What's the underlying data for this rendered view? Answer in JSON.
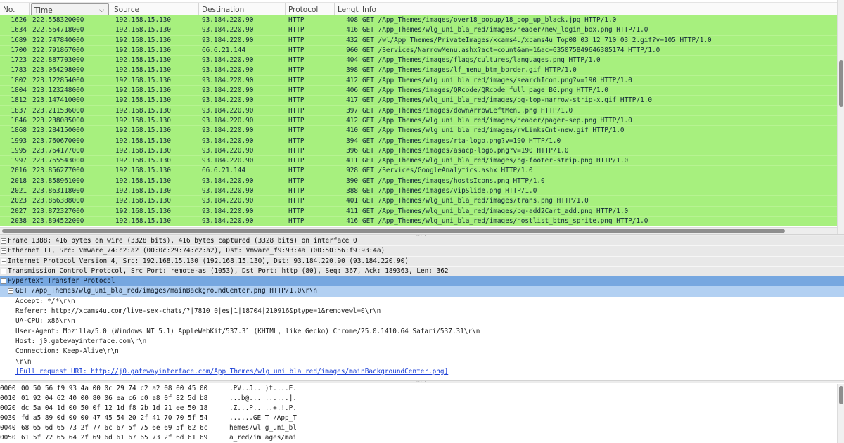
{
  "packet_list": {
    "columns": {
      "no": "No.",
      "time": "Time",
      "source": "Source",
      "destination": "Destination",
      "protocol": "Protocol",
      "length": "Lengtl",
      "info": "Info"
    },
    "rows": [
      {
        "no": "1626",
        "time": "222.558320000",
        "src": "192.168.15.130",
        "dst": "93.184.220.90",
        "proto": "HTTP",
        "len": "408",
        "info": "GET /App_Themes/images/over18_popup/18_pop_up_black.jpg HTTP/1.0"
      },
      {
        "no": "1634",
        "time": "222.564718000",
        "src": "192.168.15.130",
        "dst": "93.184.220.90",
        "proto": "HTTP",
        "len": "416",
        "info": "GET /App_Themes/wlg_uni_bla_red/images/header/new_login_box.png HTTP/1.0"
      },
      {
        "no": "1689",
        "time": "222.747840000",
        "src": "192.168.15.130",
        "dst": "93.184.220.90",
        "proto": "HTTP",
        "len": "432",
        "info": "GET /wl/App_Themes/PrivateImages/xcams4u/xcams4u_Top08_03_12_710_03_2.gif?v=105 HTTP/1.0"
      },
      {
        "no": "1700",
        "time": "222.791867000",
        "src": "192.168.15.130",
        "dst": "66.6.21.144",
        "proto": "HTTP",
        "len": "960",
        "info": "GET /Services/NarrowMenu.ashx?act=count&am=1&ac=635075849646385174 HTTP/1.0"
      },
      {
        "no": "1723",
        "time": "222.887703000",
        "src": "192.168.15.130",
        "dst": "93.184.220.90",
        "proto": "HTTP",
        "len": "404",
        "info": "GET /App_Themes/images/flags/cultures/languages.png HTTP/1.0"
      },
      {
        "no": "1783",
        "time": "223.064298000",
        "src": "192.168.15.130",
        "dst": "93.184.220.90",
        "proto": "HTTP",
        "len": "398",
        "info": "GET /App_Themes/images/lf_menu_btm_border.gif HTTP/1.0"
      },
      {
        "no": "1802",
        "time": "223.122854000",
        "src": "192.168.15.130",
        "dst": "93.184.220.90",
        "proto": "HTTP",
        "len": "412",
        "info": "GET /App_Themes/wlg_uni_bla_red/images/searchIcon.png?v=190 HTTP/1.0"
      },
      {
        "no": "1804",
        "time": "223.123248000",
        "src": "192.168.15.130",
        "dst": "93.184.220.90",
        "proto": "HTTP",
        "len": "406",
        "info": "GET /App_Themes/images/QRcode/QRcode_full_page_BG.png HTTP/1.0"
      },
      {
        "no": "1812",
        "time": "223.147410000",
        "src": "192.168.15.130",
        "dst": "93.184.220.90",
        "proto": "HTTP",
        "len": "417",
        "info": "GET /App_Themes/wlg_uni_bla_red/images/bg-top-narrow-strip-x.gif HTTP/1.0"
      },
      {
        "no": "1837",
        "time": "223.211536000",
        "src": "192.168.15.130",
        "dst": "93.184.220.90",
        "proto": "HTTP",
        "len": "397",
        "info": "GET /App_Themes/images/downArrowLeftMenu.png HTTP/1.0"
      },
      {
        "no": "1846",
        "time": "223.238085000",
        "src": "192.168.15.130",
        "dst": "93.184.220.90",
        "proto": "HTTP",
        "len": "412",
        "info": "GET /App_Themes/wlg_uni_bla_red/images/header/pager-sep.png HTTP/1.0"
      },
      {
        "no": "1868",
        "time": "223.284150000",
        "src": "192.168.15.130",
        "dst": "93.184.220.90",
        "proto": "HTTP",
        "len": "410",
        "info": "GET /App_Themes/wlg_uni_bla_red/images/rvLinksCnt-new.gif HTTP/1.0"
      },
      {
        "no": "1993",
        "time": "223.760670000",
        "src": "192.168.15.130",
        "dst": "93.184.220.90",
        "proto": "HTTP",
        "len": "394",
        "info": "GET /App_Themes/images/rta-logo.png?v=190 HTTP/1.0"
      },
      {
        "no": "1995",
        "time": "223.764177000",
        "src": "192.168.15.130",
        "dst": "93.184.220.90",
        "proto": "HTTP",
        "len": "396",
        "info": "GET /App_Themes/images/asacp-logo.png?v=190 HTTP/1.0"
      },
      {
        "no": "1997",
        "time": "223.765543000",
        "src": "192.168.15.130",
        "dst": "93.184.220.90",
        "proto": "HTTP",
        "len": "411",
        "info": "GET /App_Themes/wlg_uni_bla_red/images/bg-footer-strip.png HTTP/1.0"
      },
      {
        "no": "2016",
        "time": "223.856277000",
        "src": "192.168.15.130",
        "dst": "66.6.21.144",
        "proto": "HTTP",
        "len": "928",
        "info": "GET /Services/GoogleAnalytics.ashx HTTP/1.0"
      },
      {
        "no": "2018",
        "time": "223.858961000",
        "src": "192.168.15.130",
        "dst": "93.184.220.90",
        "proto": "HTTP",
        "len": "390",
        "info": "GET /App_Themes/images/hostsIcons.png HTTP/1.0"
      },
      {
        "no": "2021",
        "time": "223.863118000",
        "src": "192.168.15.130",
        "dst": "93.184.220.90",
        "proto": "HTTP",
        "len": "388",
        "info": "GET /App_Themes/images/vipSlide.png HTTP/1.0"
      },
      {
        "no": "2023",
        "time": "223.866388000",
        "src": "192.168.15.130",
        "dst": "93.184.220.90",
        "proto": "HTTP",
        "len": "401",
        "info": "GET /App_Themes/wlg_uni_bla_red/images/trans.png HTTP/1.0"
      },
      {
        "no": "2027",
        "time": "223.872327000",
        "src": "192.168.15.130",
        "dst": "93.184.220.90",
        "proto": "HTTP",
        "len": "411",
        "info": "GET /App_Themes/wlg_uni_bla_red/images/bg-add2Cart_add.png HTTP/1.0"
      },
      {
        "no": "2038",
        "time": "223.894522000",
        "src": "192.168.15.130",
        "dst": "93.184.220.90",
        "proto": "HTTP",
        "len": "416",
        "info": "GET /App_Themes/wlg_uni_bla_red/images/hostlist_btns_sprite.png HTTP/1.0"
      }
    ]
  },
  "details": {
    "frame": "Frame 1388: 416 bytes on wire (3328 bits), 416 bytes captured (3328 bits) on interface 0",
    "ethernet": "Ethernet II, Src: Vmware_74:c2:a2 (00:0c:29:74:c2:a2), Dst: Vmware_f9:93:4a (00:50:56:f9:93:4a)",
    "ip": "Internet Protocol Version 4, Src: 192.168.15.130 (192.168.15.130), Dst: 93.184.220.90 (93.184.220.90)",
    "tcp": "Transmission Control Protocol, Src Port: remote-as (1053), Dst Port: http (80), Seq: 367, Ack: 189363, Len: 362",
    "http": "Hypertext Transfer Protocol",
    "request_line": "GET /App_Themes/wlg_uni_bla_red/images/mainBackgroundCenter.png HTTP/1.0\\r\\n",
    "headers": [
      "Accept: */*\\r\\n",
      "Referer: http://xcams4u.com/live-sex-chats/?|7810|0|es|1|18704|210916&ptype=1&removewl=0\\r\\n",
      "UA-CPU: x86\\r\\n",
      "User-Agent: Mozilla/5.0 (Windows NT 5.1) AppleWebKit/537.31 (KHTML, like Gecko) Chrome/25.0.1410.64 Safari/537.31\\r\\n",
      "Host: j0.gatewayinterface.com\\r\\n",
      "Connection: Keep-Alive\\r\\n",
      "\\r\\n"
    ],
    "full_uri": "[Full request URI: http://j0.gatewayinterface.com/App_Themes/wlg_uni_bla_red/images/mainBackgroundCenter.png]",
    "expand_plus": "+",
    "expand_minus": "−"
  },
  "bytes": [
    {
      "offset": "0000",
      "hex": "00 50 56 f9 93 4a 00 0c  29 74 c2 a2 08 00 45 00",
      "ascii": ".PV..J.. )t....E."
    },
    {
      "offset": "0010",
      "hex": "01 92 04 62 40 00 80 06  ea c6 c0 a8 0f 82 5d b8",
      "ascii": "...b@... ......]."
    },
    {
      "offset": "0020",
      "hex": "dc 5a 04 1d 00 50 0f 12  1d f8 2b 1d 21 ee 50 18",
      "ascii": ".Z...P.. ..+.!.P."
    },
    {
      "offset": "0030",
      "hex": "fd a5 89 0d 00 00 47 45  54 20 2f 41 70 70 5f 54",
      "ascii": "......GE T /App_T"
    },
    {
      "offset": "0040",
      "hex": "68 65 6d 65 73 2f 77 6c  67 5f 75 6e 69 5f 62 6c",
      "ascii": "hemes/wl g_uni_bl"
    },
    {
      "offset": "0050",
      "hex": "61 5f 72 65 64 2f 69 6d  61 67 65 73 2f 6d 61 69",
      "ascii": "a_red/im ages/mai"
    },
    {
      "offset": "0060",
      "hex": "6e 42 61 63 6b 67 72 6f  75 6e 64 43 65 6e 74 65",
      "ascii": "nBackgro undCente"
    }
  ],
  "colors": {
    "row_http": "#a7f07e",
    "selected": "#76a7e0",
    "subselected": "#b2d0f2",
    "link": "#1b3fd6"
  }
}
